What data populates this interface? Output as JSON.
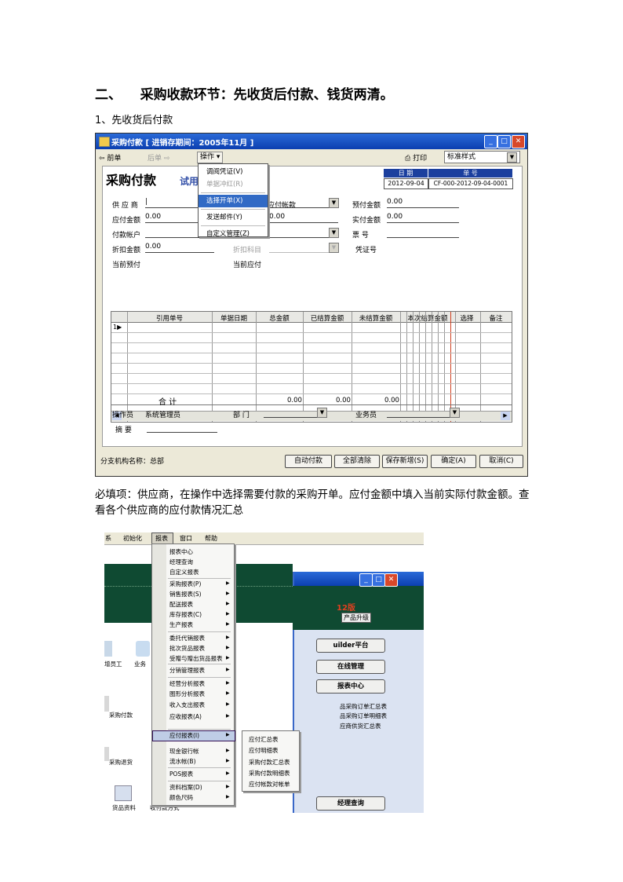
{
  "doc": {
    "heading": "二、    采购收款环节：先收货后付款、钱货两清。",
    "subheading": "1、先收货后付款",
    "note": "必填项：供应商，在操作中选择需要付款的采购开单。应付金额中填入当前实际付款金额。查看各个供应商的应付款情况汇总"
  },
  "purchase_window": {
    "title": "采购付款 [ 进销存期间：2005年11月 ]",
    "toolbar": {
      "prev": "前单",
      "next": "后单",
      "operate": "操作",
      "print": "打印",
      "style": "标准样式"
    },
    "operate_menu": [
      "调阅凭证(V)",
      "单据冲红(R)",
      "选择开单(X)",
      "发送邮件(Y)",
      "自定义管理(Z)"
    ],
    "form_title": "采购付款",
    "trial": "试用",
    "date_label": "日   期",
    "date_value": "2012-09-04",
    "no_label": "单   号",
    "no_value": "CF-000-2012-09-04-0001",
    "fields": {
      "supplier": "供 应 商",
      "supplier_value": "|",
      "payable_amount": "应付金额",
      "payable_value": "0.00",
      "pay_account": "付款帐户",
      "discount_amount": "折扣金额",
      "discount_value": "0.00",
      "current_prepay": "当前预付",
      "payable_account": "应付帐款",
      "mid_value": "0.00",
      "discount_subject": "折扣科目",
      "current_payable": "当前应付",
      "prepaid_amount": "预付金额",
      "prepaid_value": "0.00",
      "actual_paid": "实付金额",
      "actual_value": "0.00",
      "invoice_no": "票    号",
      "voucher_no": "凭证号"
    },
    "grid": {
      "headers": [
        "引用单号",
        "单据日期",
        "总金额",
        "已结算金额",
        "未结算金额",
        "本次结算金额",
        "选择",
        "备注"
      ],
      "first_row": "1",
      "total_label": "合  计",
      "totals": [
        "0.00",
        "0.00",
        "0.00"
      ]
    },
    "bottom": {
      "operator": "操作员",
      "operator_value": "系统管理员",
      "department": "部   门",
      "salesman": "业务员",
      "summary": "摘   要"
    },
    "status": "分支机构名称：总部",
    "buttons": [
      "自动付款",
      "全部清除",
      "保存新增(S)",
      "确定(A)",
      "取消(C)"
    ]
  },
  "report_window": {
    "menubar": [
      "系",
      "初始化",
      "报表",
      "窗口",
      "帮助"
    ],
    "report_menu": [
      {
        "label": "报表中心",
        "arrow": false
      },
      {
        "label": "经理查询",
        "arrow": false
      },
      {
        "label": "自定义报表",
        "arrow": false
      },
      {
        "label": "采购报表(P)",
        "arrow": true
      },
      {
        "label": "销售报表(S)",
        "arrow": true
      },
      {
        "label": "配送报表",
        "arrow": true
      },
      {
        "label": "库存报表(C)",
        "arrow": true
      },
      {
        "label": "生产报表",
        "arrow": true
      },
      {
        "label": "委托代销报表",
        "arrow": true
      },
      {
        "label": "批次货品报表",
        "arrow": true
      },
      {
        "label": "受赠与赠出货品报表",
        "arrow": true
      },
      {
        "label": "分销管理报表",
        "arrow": true
      },
      {
        "label": "经营分析报表",
        "arrow": true
      },
      {
        "label": "图形分析报表",
        "arrow": true
      },
      {
        "label": "收入支出报表",
        "arrow": true
      },
      {
        "label": "应收报表(A)",
        "arrow": true
      },
      {
        "label": "应付报表(I)",
        "arrow": true
      },
      {
        "label": "现金银行帐",
        "arrow": true
      },
      {
        "label": "流水帐(B)",
        "arrow": true
      },
      {
        "label": "POS报表",
        "arrow": true
      },
      {
        "label": "资料档案(D)",
        "arrow": true
      },
      {
        "label": "颜色尺码",
        "arrow": true
      }
    ],
    "payable_submenu": [
      "应付汇总表",
      "应付明细表",
      "采购付款汇总表",
      "采购付款明细表",
      "应付帐款对帐单"
    ],
    "background": {
      "version": "12版",
      "upgrade": "产品升级",
      "builder": "uilder平台",
      "online": "在线管理",
      "report_center": "报表中心",
      "purchase_order_summary": "品采购订单汇总表",
      "purchase_order_detail": "品采购订单明细表",
      "supplier_summary": "应商供货汇总表",
      "manager_query": "经理查询",
      "icons": [
        "增员工",
        "业务",
        "采购付款",
        "采购退货",
        "货品资料",
        "收付款方式"
      ]
    }
  }
}
